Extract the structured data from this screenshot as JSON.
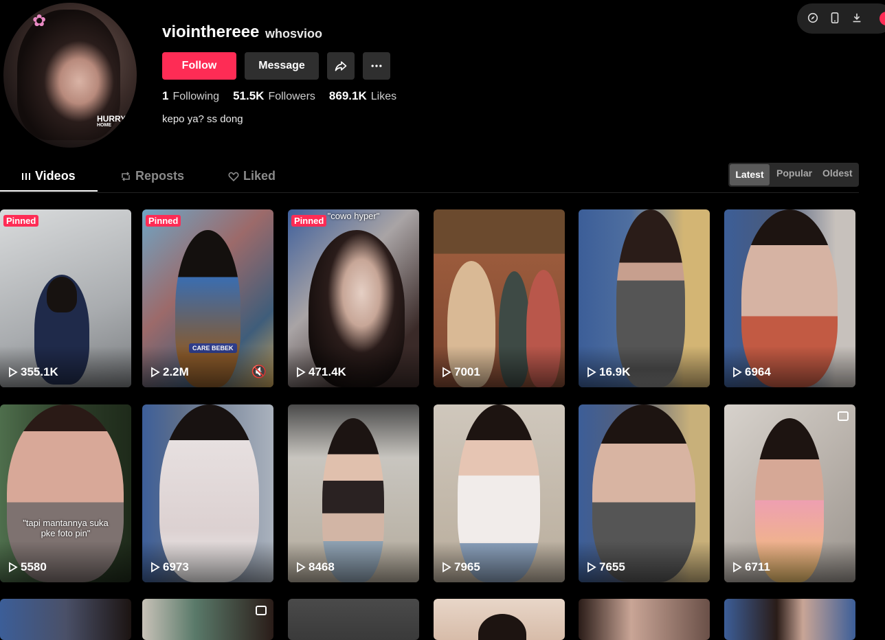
{
  "profile": {
    "username": "viointhereee",
    "nickname": "whosvioo",
    "avatar_watermark": "HURRY",
    "avatar_watermark_sub": "HOME",
    "bio": "kepo ya? ss dong",
    "stats": {
      "following_count": "1",
      "following_label": "Following",
      "followers_count": "51.5K",
      "followers_label": "Followers",
      "likes_count": "869.1K",
      "likes_label": "Likes"
    }
  },
  "actions": {
    "follow_label": "Follow",
    "message_label": "Message",
    "share_icon": "share-arrow-icon",
    "more_icon": "ellipsis-icon"
  },
  "topbar": {
    "icons": [
      "compass-icon",
      "phone-icon",
      "download-icon"
    ]
  },
  "tabs": [
    {
      "label": "Videos",
      "icon": "grid-bars-icon",
      "active": true
    },
    {
      "label": "Reposts",
      "icon": "repost-icon",
      "active": false
    },
    {
      "label": "Liked",
      "icon": "heart-outline-icon",
      "active": false
    }
  ],
  "sort": {
    "options": [
      "Latest",
      "Popular",
      "Oldest"
    ],
    "selected": "Latest"
  },
  "colors": {
    "accent": "#fe2c55",
    "background": "#000000",
    "button_bg": "#2f2f2f"
  },
  "videos": [
    {
      "views": "355.1K",
      "pinned": "Pinned"
    },
    {
      "views": "2.2M",
      "pinned": "Pinned",
      "badge": "CARE BEBEK",
      "muted_icon": "muted-speaker-icon"
    },
    {
      "views": "471.4K",
      "pinned": "Pinned",
      "caption": "\"cowo hyper\""
    },
    {
      "views": "7001"
    },
    {
      "views": "16.9K"
    },
    {
      "views": "6964"
    },
    {
      "views": "5580",
      "caption": "\"tapi mantannya suka pke foto pin\""
    },
    {
      "views": "6973"
    },
    {
      "views": "8468"
    },
    {
      "views": "7965"
    },
    {
      "views": "7655"
    },
    {
      "views": "6711",
      "photo_icon": "photo-post-icon"
    }
  ]
}
